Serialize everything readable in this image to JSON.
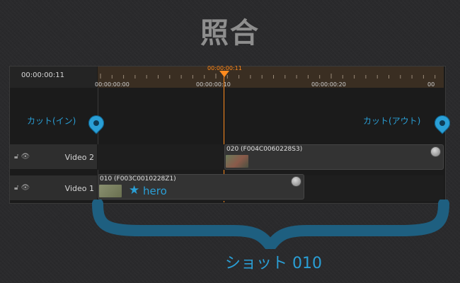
{
  "title": "照合",
  "timecode_display": "00:00:00:11",
  "playhead_time": "00:00:00:11",
  "ruler_labels": [
    "00:00:00:00",
    "00:00:00:10",
    "00:00:00:20",
    "00"
  ],
  "markers": {
    "in_label": "カット(イン)",
    "out_label": "カット(アウト)"
  },
  "tracks": [
    {
      "name": "Video 2",
      "clip_name": "020 (F004C0060228S3)"
    },
    {
      "name": "Video 1",
      "clip_name": "010 (F003C0010228Z1)",
      "tag": "hero"
    }
  ],
  "shot_label": "ショット 010",
  "colors": {
    "accent": "#2a9fd6",
    "playhead": "#ff8a1e"
  }
}
